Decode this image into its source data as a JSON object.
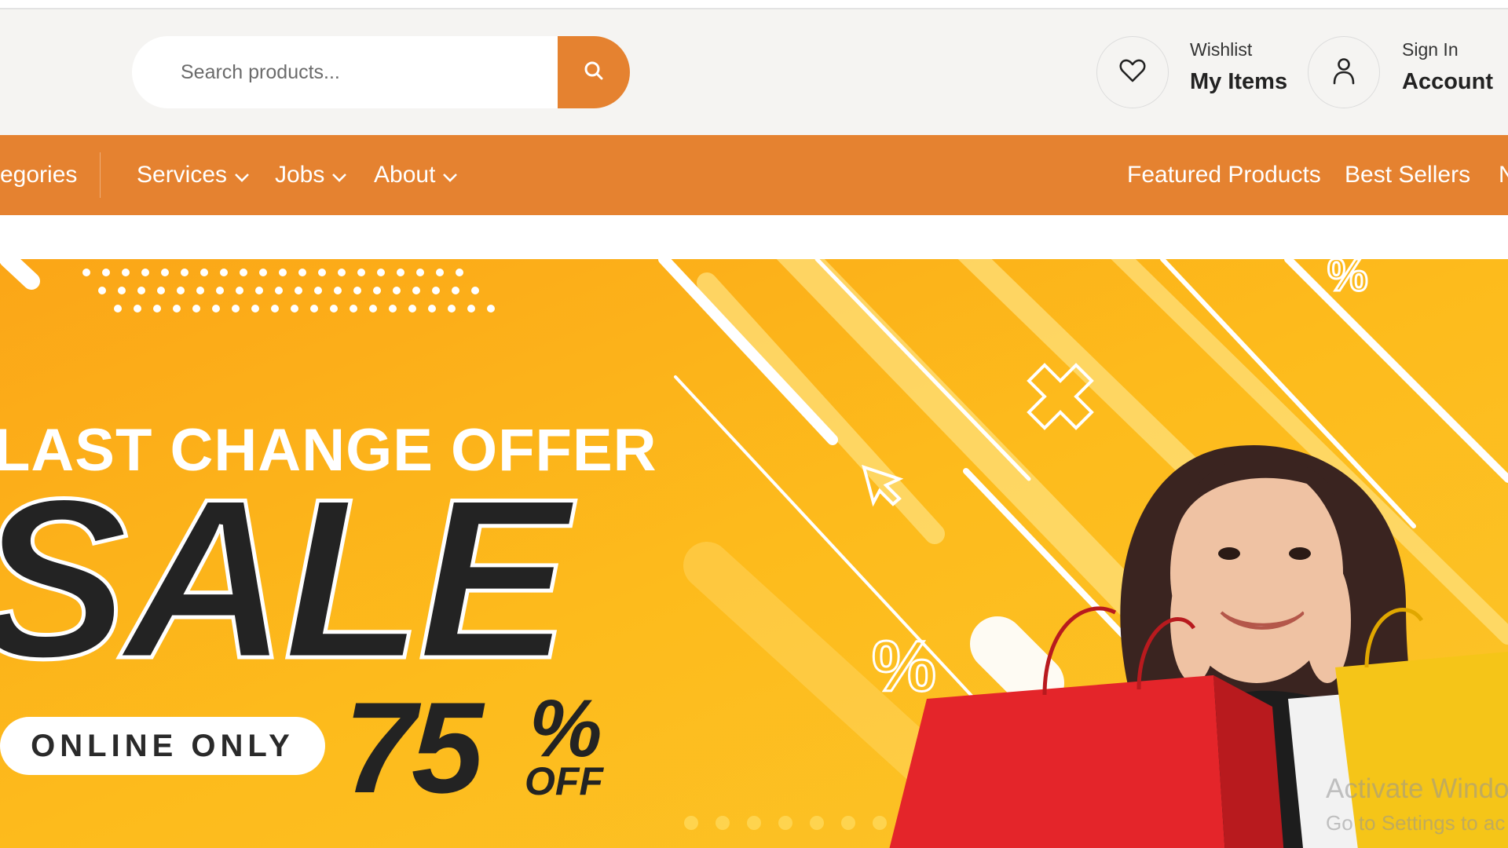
{
  "search": {
    "placeholder": "Search products..."
  },
  "header": {
    "wishlist": {
      "label": "Wishlist",
      "value": "My Items"
    },
    "account": {
      "label": "Sign In",
      "value": "Account"
    }
  },
  "nav": {
    "left": [
      "egories",
      "Services",
      "Jobs",
      "About"
    ],
    "right": [
      "Featured Products",
      "Best Sellers",
      "N"
    ]
  },
  "banner": {
    "headline": "LAST CHANGE OFFER",
    "sale": "SALE",
    "online_only": "ONLINE ONLY",
    "discount_number": "75",
    "discount_percent": "%",
    "discount_off": "OFF",
    "graphics_percent": "%"
  },
  "os_watermark": {
    "line1": "Activate Windo",
    "line2": "Go to Settings to ac"
  },
  "colors": {
    "accent": "#e58230",
    "banner_yellow": "#fdb813",
    "header_bg": "#f5f4f2"
  }
}
